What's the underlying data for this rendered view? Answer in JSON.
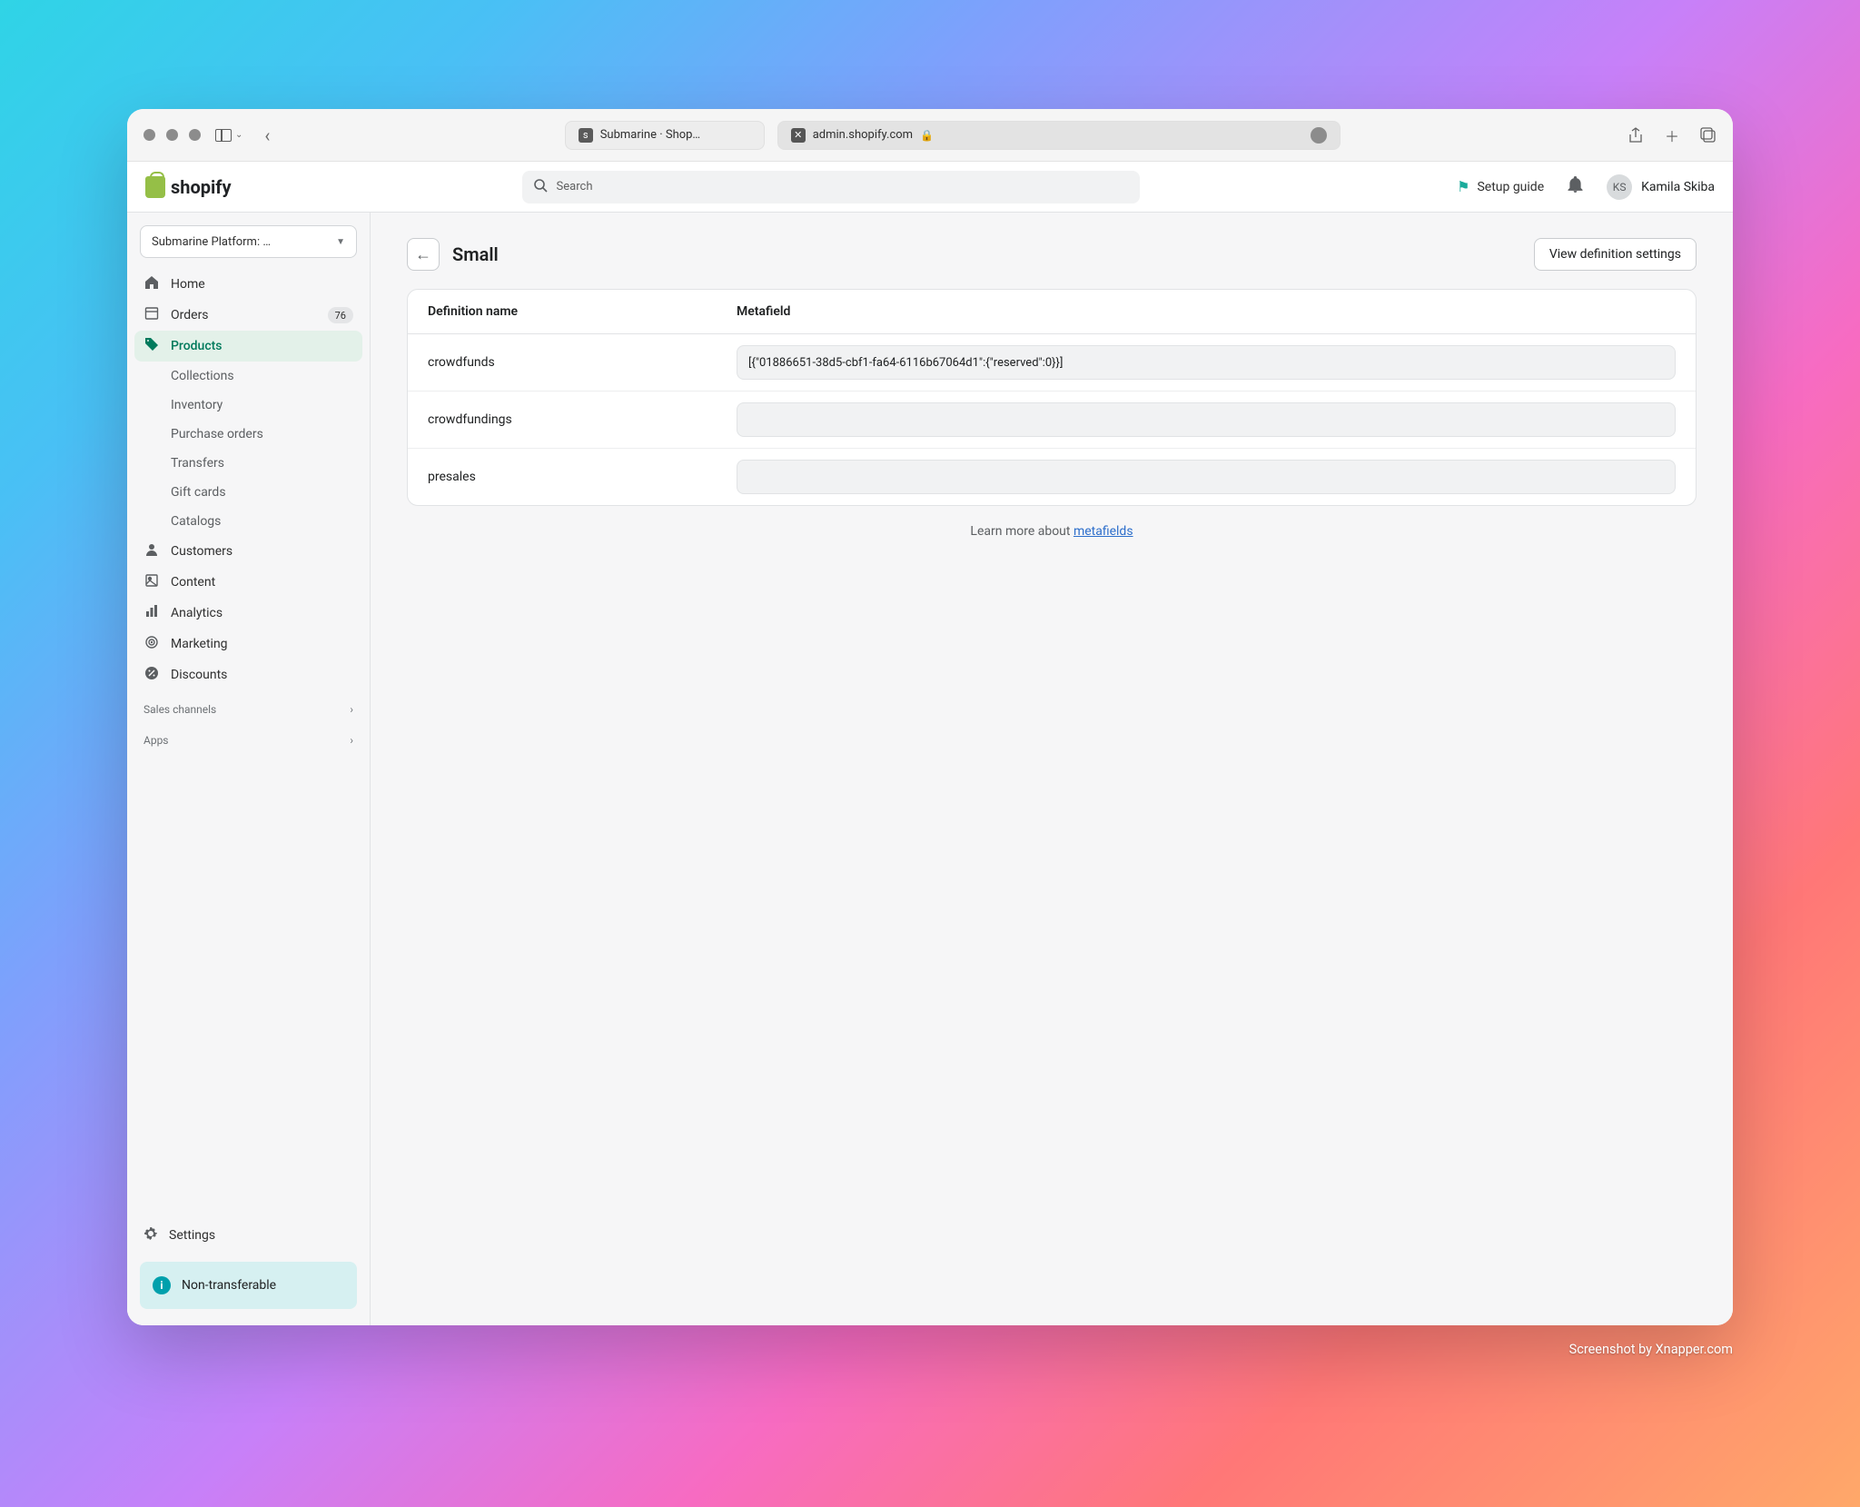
{
  "browser": {
    "tabs": [
      {
        "label": "Submarine · Shop…"
      },
      {
        "label": "admin.shopify.com"
      }
    ]
  },
  "header": {
    "logo_text": "shopify",
    "search_placeholder": "Search",
    "setup_guide": "Setup guide",
    "user_initials": "KS",
    "user_name": "Kamila Skiba"
  },
  "sidebar": {
    "store_name": "Submarine Platform: …",
    "nav": [
      {
        "label": "Home",
        "icon": "home"
      },
      {
        "label": "Orders",
        "icon": "orders",
        "badge": "76"
      },
      {
        "label": "Products",
        "icon": "tag",
        "active": true
      },
      {
        "label": "Customers",
        "icon": "person"
      },
      {
        "label": "Content",
        "icon": "content"
      },
      {
        "label": "Analytics",
        "icon": "analytics"
      },
      {
        "label": "Marketing",
        "icon": "marketing"
      },
      {
        "label": "Discounts",
        "icon": "discount"
      }
    ],
    "subnav": [
      {
        "label": "Collections"
      },
      {
        "label": "Inventory"
      },
      {
        "label": "Purchase orders"
      },
      {
        "label": "Transfers"
      },
      {
        "label": "Gift cards"
      },
      {
        "label": "Catalogs"
      }
    ],
    "sections": {
      "sales_channels": "Sales channels",
      "apps": "Apps"
    },
    "settings": "Settings",
    "notice": "Non-transferable"
  },
  "page": {
    "title": "Small",
    "view_settings_label": "View definition settings",
    "columns": {
      "name": "Definition name",
      "metafield": "Metafield"
    },
    "rows": [
      {
        "name": "crowdfunds",
        "value": "[{\"01886651-38d5-cbf1-fa64-6116b67064d1\":{\"reserved\":0}}]"
      },
      {
        "name": "crowdfundings",
        "value": ""
      },
      {
        "name": "presales",
        "value": ""
      }
    ],
    "learn_more_prefix": "Learn more about ",
    "learn_more_link": "metafields"
  },
  "footer": {
    "credit": "Screenshot by Xnapper.com"
  }
}
